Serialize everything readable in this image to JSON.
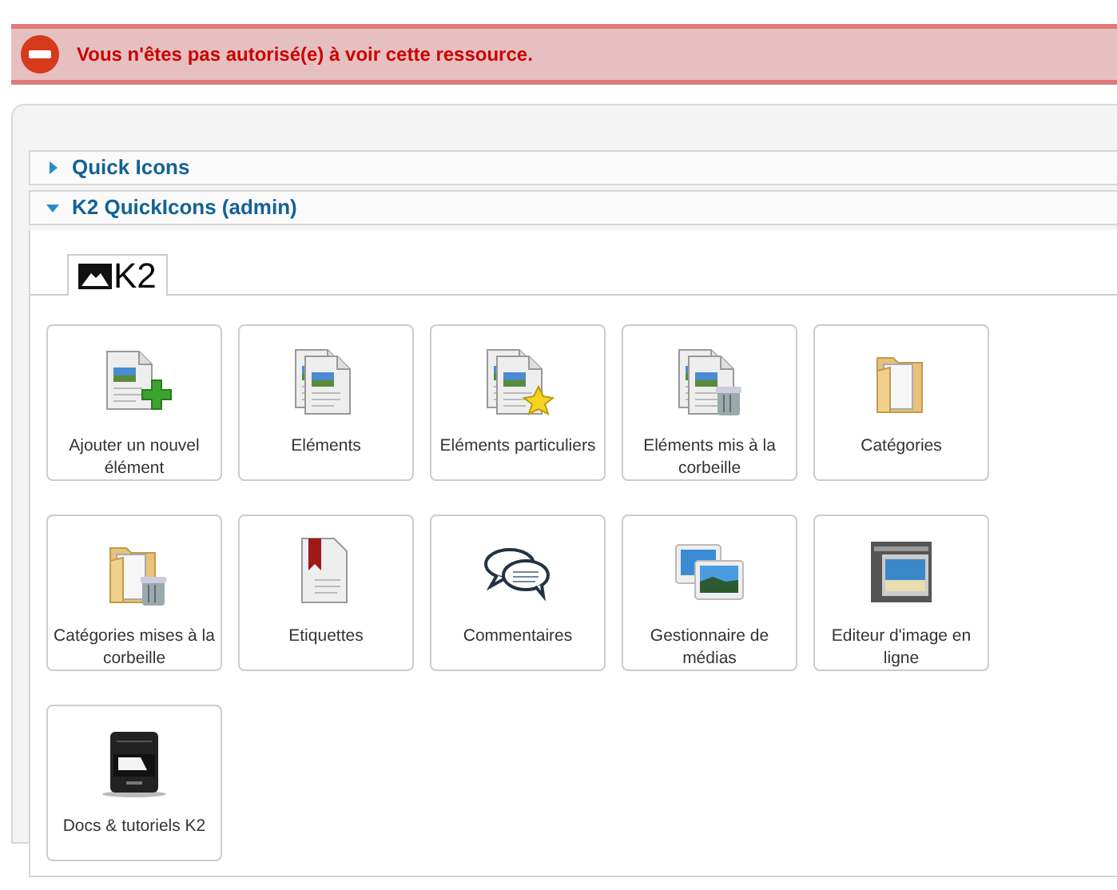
{
  "error_message": "Vous n'êtes pas autorisé(e) à voir cette ressource.",
  "sections": [
    {
      "title": "Quick Icons",
      "expanded": false
    },
    {
      "title": "K2 QuickIcons (admin)",
      "expanded": true
    }
  ],
  "tab": {
    "label": "K2",
    "selected": true
  },
  "tiles": [
    {
      "label": "Ajouter un nouvel élément"
    },
    {
      "label": "Eléments"
    },
    {
      "label": "Eléments particuliers"
    },
    {
      "label": "Eléments mis à la corbeille"
    },
    {
      "label": "Catégories"
    },
    {
      "label": "Catégories mises à la corbeille"
    },
    {
      "label": "Etiquettes"
    },
    {
      "label": "Commentaires"
    },
    {
      "label": "Gestionnaire de médias"
    },
    {
      "label": "Editeur d'image en ligne"
    },
    {
      "label": "Docs & tutoriels K2"
    }
  ]
}
